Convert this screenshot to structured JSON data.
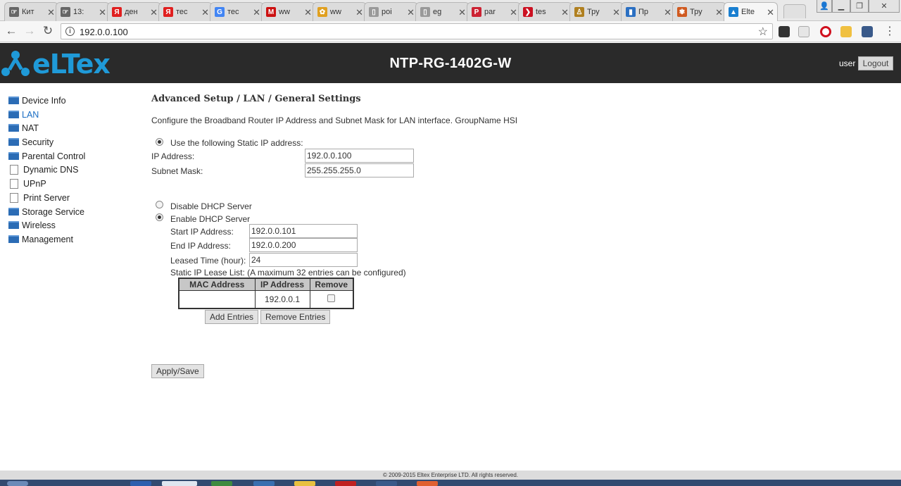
{
  "browser": {
    "tabs": [
      {
        "title": "Кит",
        "icon": "finger-icon",
        "color": "#666"
      },
      {
        "title": "13:",
        "icon": "finger-icon",
        "color": "#666"
      },
      {
        "title": "ден",
        "icon": "yandex-icon",
        "color": "#e02020"
      },
      {
        "title": "тес",
        "icon": "yandex-icon",
        "color": "#e02020"
      },
      {
        "title": "тес",
        "icon": "google-icon",
        "color": "#4285f4"
      },
      {
        "title": "ww",
        "icon": "mail-icon",
        "color": "#cc1111"
      },
      {
        "title": "ww",
        "icon": "cat-icon",
        "color": "#e0a020"
      },
      {
        "title": "poi",
        "icon": "page-icon",
        "color": "#999"
      },
      {
        "title": "eg",
        "icon": "page-icon",
        "color": "#999"
      },
      {
        "title": "par",
        "icon": "parser-icon",
        "color": "#cc2233"
      },
      {
        "title": "tes",
        "icon": "arrow-icon",
        "color": "#cc1122"
      },
      {
        "title": "Тру",
        "icon": "man-icon",
        "color": "#b08020"
      },
      {
        "title": "Пр",
        "icon": "bookmark-icon",
        "color": "#2a6fc2"
      },
      {
        "title": "Тру",
        "icon": "cake-icon",
        "color": "#d05a20"
      },
      {
        "title": "Elte",
        "icon": "eltex-icon",
        "color": "#1a7fd0",
        "active": true
      }
    ],
    "url": "192.0.0.100"
  },
  "header": {
    "logo": "eltex",
    "device_name": "NTP-RG-1402G-W",
    "user": "user",
    "logout_label": "Logout"
  },
  "sidebar": {
    "items": [
      {
        "label": "Device Info",
        "icon": "folder-icon"
      },
      {
        "label": "LAN",
        "icon": "folder-icon",
        "active": true
      },
      {
        "label": "NAT",
        "icon": "folder-icon"
      },
      {
        "label": "Security",
        "icon": "folder-icon"
      },
      {
        "label": "Parental Control",
        "icon": "folder-icon"
      },
      {
        "label": "Dynamic DNS",
        "icon": "page-icon"
      },
      {
        "label": "UPnP",
        "icon": "page-icon"
      },
      {
        "label": "Print Server",
        "icon": "page-icon"
      },
      {
        "label": "Storage Service",
        "icon": "folder-icon"
      },
      {
        "label": "Wireless",
        "icon": "folder-icon"
      },
      {
        "label": "Management",
        "icon": "folder-icon"
      }
    ]
  },
  "main": {
    "title": "Advanced Setup / LAN / General Settings",
    "description": "Configure the Broadband Router IP Address and Subnet Mask for LAN interface.  GroupName HSI",
    "static_ip_option": "Use the following Static IP address:",
    "ip_address_label": "IP Address:",
    "ip_address_value": "192.0.0.100",
    "subnet_mask_label": "Subnet Mask:",
    "subnet_mask_value": "255.255.255.0",
    "disable_dhcp_label": "Disable DHCP Server",
    "enable_dhcp_label": "Enable DHCP Server",
    "start_ip_label": "Start IP Address:",
    "start_ip_value": "192.0.0.101",
    "end_ip_label": "End IP Address:",
    "end_ip_value": "192.0.0.200",
    "lease_time_label": "Leased Time (hour):",
    "lease_time_value": "24",
    "static_lease_label": "Static IP Lease List: (A maximum 32 entries can be configured)",
    "table": {
      "headers": [
        "MAC Address",
        "IP Address",
        "Remove"
      ],
      "rows": [
        {
          "mac": "",
          "ip": "192.0.0.1",
          "remove": false
        }
      ]
    },
    "add_entries_label": "Add Entries",
    "remove_entries_label": "Remove Entries",
    "apply_save_label": "Apply/Save"
  },
  "footer": {
    "copyright": "© 2009-2015 Eltex Enterprise LTD. All rights reserved."
  }
}
